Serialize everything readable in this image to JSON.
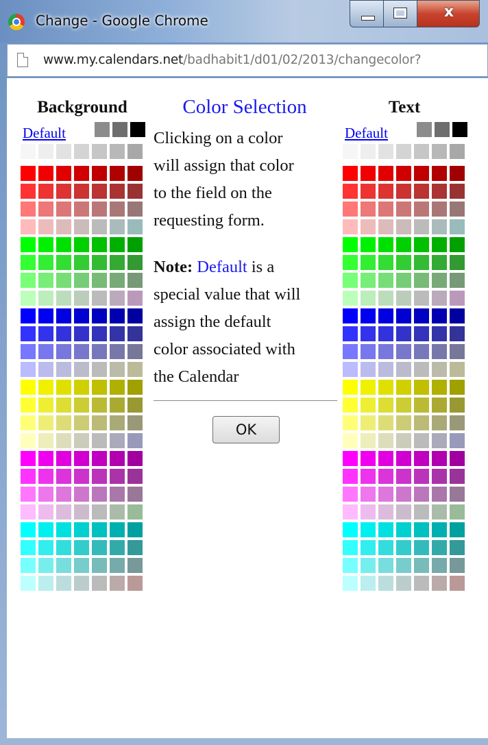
{
  "window": {
    "title": "Change - Google Chrome",
    "close_glyph": "x",
    "url_host": "www.my.calendars.net",
    "url_path": "/badhabit1/d01/02/2013/changecolor?"
  },
  "palettes": {
    "background": {
      "header": "Background",
      "default_label": "Default"
    },
    "text": {
      "header": "Text",
      "default_label": "Default"
    }
  },
  "center": {
    "title": "Color Selection",
    "line1": "Clicking on a color",
    "line2": "will assign that color",
    "line3": "to the field on the",
    "line4": "requesting form.",
    "note_label": "Note:",
    "note_default": "Default",
    "note_rest": " is a",
    "line6": "special value that will",
    "line7": "assign the default",
    "line8": "color associated with",
    "line9": "the Calendar",
    "ok_label": "OK"
  },
  "colors": {
    "gray_top": [
      "#8c8c8c",
      "#6e6e6e",
      "#000000"
    ],
    "gray_row": [
      "#f6f6f6",
      "#eeeeee",
      "#e2e2e2",
      "#d4d4d4",
      "#c6c6c6",
      "#b8b8b8",
      "#a8a8a8"
    ],
    "rows": [
      [
        "#ff0000",
        "#f00000",
        "#e00000",
        "#d00000",
        "#c00000",
        "#b00000",
        "#a00000"
      ],
      [
        "#ff3333",
        "#ee3333",
        "#dd3333",
        "#cc3333",
        "#bb3333",
        "#aa3333",
        "#993333"
      ],
      [
        "#ff7777",
        "#ee7777",
        "#dd7777",
        "#cc7777",
        "#bb7777",
        "#aa7777",
        "#997777"
      ],
      [
        "#ffbbbb",
        "#eebbbb",
        "#ddbbbb",
        "#ccbbbb",
        "#bbbbbb",
        "#aabbbb",
        "#99bbbb"
      ],
      [
        "#00ff00",
        "#00f000",
        "#00e000",
        "#00d000",
        "#00c000",
        "#00b000",
        "#00a000"
      ],
      [
        "#33ff33",
        "#33ee33",
        "#33dd33",
        "#33cc33",
        "#33bb33",
        "#33aa33",
        "#339933"
      ],
      [
        "#77ff77",
        "#77ee77",
        "#77dd77",
        "#77cc77",
        "#77bb77",
        "#77aa77",
        "#779977"
      ],
      [
        "#bbffbb",
        "#bbeebb",
        "#bbddbb",
        "#bbccbb",
        "#bbbbbb",
        "#bbaabb",
        "#bb99bb"
      ],
      [
        "#0000ff",
        "#0000f0",
        "#0000e0",
        "#0000d0",
        "#0000c0",
        "#0000b0",
        "#0000a0"
      ],
      [
        "#3333ff",
        "#3333ee",
        "#3333dd",
        "#3333cc",
        "#3333bb",
        "#3333aa",
        "#333399"
      ],
      [
        "#7777ff",
        "#7777ee",
        "#7777dd",
        "#7777cc",
        "#7777bb",
        "#7777aa",
        "#777799"
      ],
      [
        "#bbbbff",
        "#bbbbee",
        "#bbbbdd",
        "#bbbbcc",
        "#bbbbbb",
        "#bbbbaa",
        "#bbbb99"
      ],
      [
        "#ffff00",
        "#f0f000",
        "#e0e000",
        "#d0d000",
        "#c0c000",
        "#b0b000",
        "#a0a000"
      ],
      [
        "#ffff33",
        "#eeee33",
        "#dddd33",
        "#cccc33",
        "#bbbb33",
        "#aaaa33",
        "#999933"
      ],
      [
        "#ffff77",
        "#eeee77",
        "#dddd77",
        "#cccc77",
        "#bbbb77",
        "#aaaa77",
        "#999977"
      ],
      [
        "#ffffbb",
        "#eeeebb",
        "#ddddbb",
        "#ccccbb",
        "#bbbbbb",
        "#aaaabb",
        "#9999bb"
      ],
      [
        "#ff00ff",
        "#f000f0",
        "#e000e0",
        "#d000d0",
        "#c000c0",
        "#b000b0",
        "#a000a0"
      ],
      [
        "#ff33ff",
        "#ee33ee",
        "#dd33dd",
        "#cc33cc",
        "#bb33bb",
        "#aa33aa",
        "#993399"
      ],
      [
        "#ff77ff",
        "#ee77ee",
        "#dd77dd",
        "#cc77cc",
        "#bb77bb",
        "#aa77aa",
        "#997799"
      ],
      [
        "#ffbbff",
        "#eebbee",
        "#ddbbdd",
        "#ccbbcc",
        "#bbbbbb",
        "#aabbaa",
        "#99bb99"
      ],
      [
        "#00ffff",
        "#00f0f0",
        "#00e0e0",
        "#00d0d0",
        "#00c0c0",
        "#00b0b0",
        "#00a0a0"
      ],
      [
        "#33ffff",
        "#33eeee",
        "#33dddd",
        "#33cccc",
        "#33bbbb",
        "#33aaaa",
        "#339999"
      ],
      [
        "#77ffff",
        "#77eeee",
        "#77dddd",
        "#77cccc",
        "#77bbbb",
        "#77aaaa",
        "#779999"
      ],
      [
        "#bbffff",
        "#bbeeee",
        "#bbdddd",
        "#bbcccc",
        "#bbbbbb",
        "#bbaaaa",
        "#bb9999"
      ]
    ]
  }
}
